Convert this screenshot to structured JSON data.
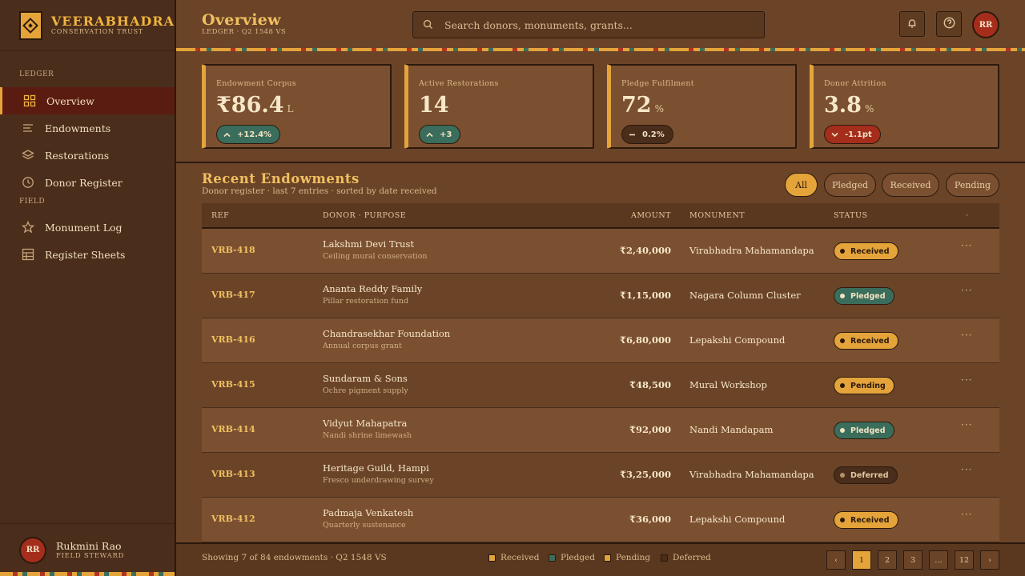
{
  "brand": {
    "title": "VEERABHADRA",
    "subtitle": "CONSERVATION TRUST"
  },
  "sidebar": {
    "sections": [
      "LEDGER",
      "FIELD"
    ],
    "items": [
      {
        "label": "Overview",
        "icon": "grid-icon",
        "active": true
      },
      {
        "label": "Endowments",
        "icon": "list-icon"
      },
      {
        "label": "Restorations",
        "icon": "layers-icon"
      },
      {
        "label": "Donor Register",
        "icon": "clock-icon"
      },
      {
        "label": "Monument Log",
        "icon": "star-icon"
      },
      {
        "label": "Register Sheets",
        "icon": "table-icon"
      }
    ],
    "user": {
      "initials": "RR",
      "name": "Rukmini Rao",
      "role": "FIELD STEWARD"
    }
  },
  "header": {
    "title": "Overview",
    "subtitle": "LEDGER · Q2 1548 VS",
    "search_placeholder": "Search donors, monuments, grants...",
    "avatar_initials": "RR"
  },
  "stats": [
    {
      "label": "Endowment Corpus",
      "value": "₹86.4",
      "unit": "L",
      "delta": "+12.4%",
      "trend": "up"
    },
    {
      "label": "Active Restorations",
      "value": "14",
      "unit": "",
      "delta": "+3",
      "trend": "up"
    },
    {
      "label": "Pledge Fulfilment",
      "value": "72",
      "unit": "%",
      "delta": "0.2%",
      "trend": "flat"
    },
    {
      "label": "Donor Attrition",
      "value": "3.8",
      "unit": "%",
      "delta": "-1.1pt",
      "trend": "down"
    }
  ],
  "endowments": {
    "title": "Recent Endowments",
    "subtitle": "Donor register · last 7 entries · sorted by date received",
    "filters": [
      "All",
      "Pledged",
      "Received",
      "Pending"
    ],
    "columns": [
      "REF",
      "DONOR · PURPOSE",
      "AMOUNT",
      "MONUMENT",
      "STATUS",
      "·"
    ],
    "rows": [
      {
        "ref": "VRB-418",
        "donor": "Lakshmi Devi Trust",
        "purpose": "Ceiling mural conservation",
        "amount": "₹2,40,000",
        "monument": "Virabhadra Mahamandapa",
        "status": "Received"
      },
      {
        "ref": "VRB-417",
        "donor": "Ananta Reddy Family",
        "purpose": "Pillar restoration fund",
        "amount": "₹1,15,000",
        "monument": "Nagara Column Cluster",
        "status": "Pledged"
      },
      {
        "ref": "VRB-416",
        "donor": "Chandrasekhar Foundation",
        "purpose": "Annual corpus grant",
        "amount": "₹6,80,000",
        "monument": "Lepakshi Compound",
        "status": "Received"
      },
      {
        "ref": "VRB-415",
        "donor": "Sundaram & Sons",
        "purpose": "Ochre pigment supply",
        "amount": "₹48,500",
        "monument": "Mural Workshop",
        "status": "Pending"
      },
      {
        "ref": "VRB-414",
        "donor": "Vidyut Mahapatra",
        "purpose": "Nandi shrine limewash",
        "amount": "₹92,000",
        "monument": "Nandi Mandapam",
        "status": "Pledged"
      },
      {
        "ref": "VRB-413",
        "donor": "Heritage Guild, Hampi",
        "purpose": "Fresco underdrawing survey",
        "amount": "₹3,25,000",
        "monument": "Virabhadra Mahamandapa",
        "status": "Deferred"
      },
      {
        "ref": "VRB-412",
        "donor": "Padmaja Venkatesh",
        "purpose": "Quarterly sustenance",
        "amount": "₹36,000",
        "monument": "Lepakshi Compound",
        "status": "Received"
      }
    ],
    "more_glyph": "···"
  },
  "footer": {
    "summary": "Showing 7 of 84 endowments · Q2 1548 VS",
    "legend": [
      {
        "label": "Received",
        "color": "#e5a43a"
      },
      {
        "label": "Pledged",
        "color": "#3a6d5c"
      },
      {
        "label": "Pending",
        "color": "#e5a43a"
      },
      {
        "label": "Deferred",
        "color": "#4a2d1a"
      }
    ],
    "pages": [
      "‹",
      "1",
      "2",
      "3",
      "…",
      "12",
      "›"
    ],
    "current_page": "1"
  },
  "colors": {
    "accent": "#e5a43a",
    "pledged": "#3a6d5c",
    "alert": "#a52d1c",
    "background": "#6b4428"
  }
}
